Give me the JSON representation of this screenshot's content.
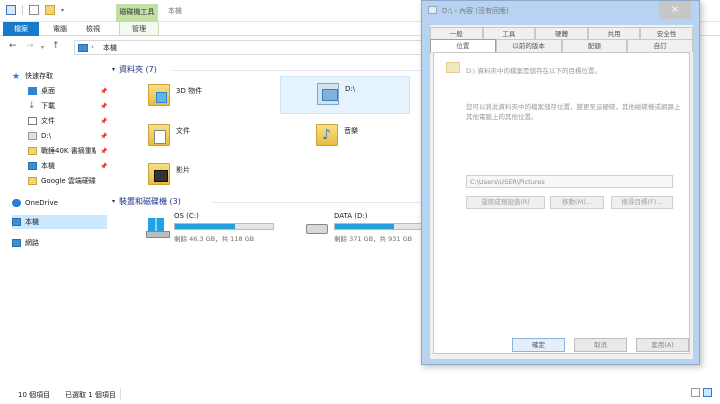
{
  "title": {
    "context_tab": "磁碟機工具",
    "window_title": "本機"
  },
  "ribbon": {
    "tabs": [
      "檔案",
      "電腦",
      "檢視",
      "管理"
    ]
  },
  "address": {
    "path": "本機"
  },
  "nav": {
    "quick_access": "快速存取",
    "items": [
      {
        "label": "桌面",
        "icon": "desktop-icon"
      },
      {
        "label": "下載",
        "icon": "download-icon"
      },
      {
        "label": "文件",
        "icon": "document-icon"
      },
      {
        "label": "D:\\",
        "icon": "drive-icon"
      },
      {
        "label": "戰錘40K 書摘重點",
        "icon": "folder-icon"
      },
      {
        "label": "本機",
        "icon": "computer-icon"
      },
      {
        "label": "Google 雲端硬碟",
        "icon": "folder-icon"
      }
    ],
    "onedrive": "OneDrive",
    "this_pc": "本機",
    "network": "網路"
  },
  "content": {
    "folders_header": "資料夾 (7)",
    "folders": [
      {
        "label": "3D 物件"
      },
      {
        "label": "D:\\"
      },
      {
        "label": "文件"
      },
      {
        "label": "音樂"
      },
      {
        "label": "影片"
      }
    ],
    "drives_header": "裝置和磁碟機 (3)",
    "drives": [
      {
        "name": "OS (C:)",
        "size": "剩餘 46.3 GB，共 118 GB",
        "used_fraction": 0.61
      },
      {
        "name": "DATA (D:)",
        "size": "剩餘 371 GB，共 931 GB",
        "used_fraction": 0.6
      }
    ]
  },
  "status": {
    "items_count": "10 個項目",
    "selected": "已選取 1 個項目"
  },
  "dialog": {
    "title": "D:\\ - 內容 (沒有回應)",
    "tabs_row1": [
      "一般",
      "工具",
      "硬體",
      "共用",
      "安全性"
    ],
    "tabs_row2": [
      "位置",
      "以前的版本",
      "配額",
      "自訂"
    ],
    "panel_text1": "D:\\ 資料夾中的檔案是儲存在以下的目標位置。",
    "panel_text2": "您可以將此資料夾中的檔案儲存位置，變更至這硬碟，其他磁碟機或網路上其他電腦上的其他位置。",
    "path_value": "C:\\Users\\USER\\Pictures",
    "btn_restore": "還原成預設值(R)",
    "btn_move": "移動(M)...",
    "btn_find": "搜尋目標(F)...",
    "ok": "確定",
    "cancel": "取消",
    "apply": "套用(A)"
  }
}
